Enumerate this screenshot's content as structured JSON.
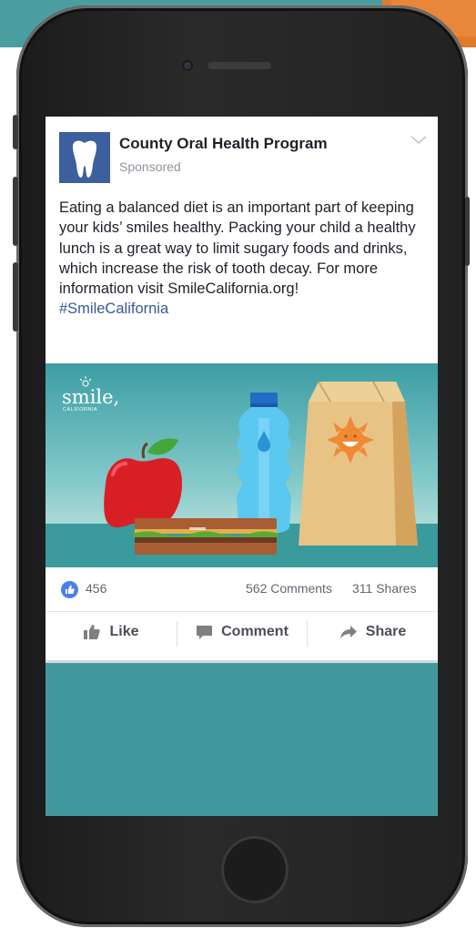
{
  "post": {
    "page_name": "County Oral Health Program",
    "sponsored_label": "Sponsored",
    "body_text": "Eating a balanced diet is an important part of keeping your kids’ smiles healthy. Packing your child a healthy lunch is a great way to limit sugary foods and drinks, which increase the risk of tooth decay. For more information visit SmileCalifornia.org!",
    "hashtag": "#SmileCalifornia",
    "image_logo_text": "smile,",
    "image_logo_subtext": "CALIFORNIA"
  },
  "stats": {
    "likes": "456",
    "comments": "562 Comments",
    "shares": "311 Shares"
  },
  "actions": {
    "like": "Like",
    "comment": "Comment",
    "share": "Share"
  },
  "icons": [
    "tooth-icon",
    "chevron-down-icon",
    "thumbs-up-icon",
    "comment-icon",
    "share-arrow-icon"
  ],
  "colors": {
    "brand_blue": "#3d5f9e",
    "link": "#365899",
    "reaction_blue": "#4b7ff0",
    "teal": "#42999d",
    "orange": "#e07a2d"
  }
}
